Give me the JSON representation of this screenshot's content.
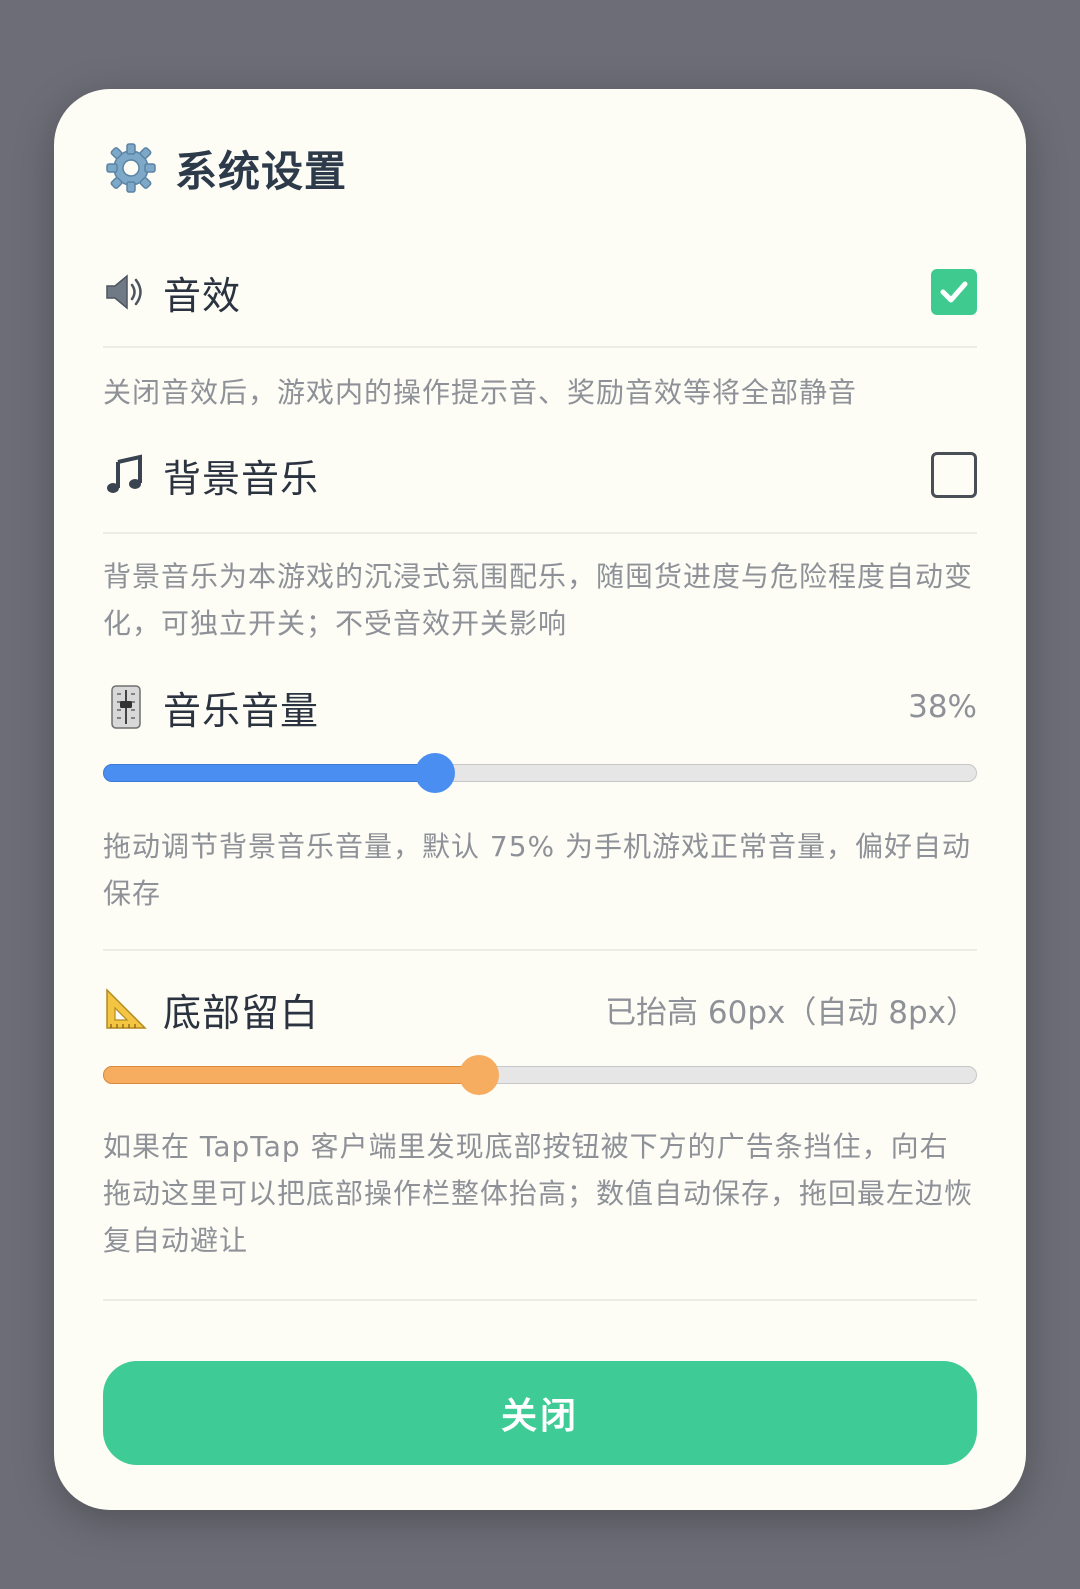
{
  "dialog": {
    "title": "系统设置",
    "title_icon": "gear-icon",
    "close_label": "关闭"
  },
  "settings": {
    "sound_effects": {
      "icon": "speaker-icon",
      "label": "音效",
      "checked": true,
      "description": "关闭音效后，游戏内的操作提示音、奖励音效等将全部静音"
    },
    "background_music": {
      "icon": "music-note-icon",
      "label": "背景音乐",
      "checked": false,
      "description": "背景音乐为本游戏的沉浸式氛围配乐，随囤货进度与危险程度自动变化，可独立开关；不受音效开关影响"
    },
    "music_volume": {
      "icon": "mixer-slider-icon",
      "label": "音乐音量",
      "value_text": "38%",
      "value": 0.38,
      "description": "拖动调节背景音乐音量，默认 75% 为手机游戏正常音量，偏好自动保存"
    },
    "bottom_margin": {
      "icon": "triangular-ruler-icon",
      "label": "底部留白",
      "value_text": "已抬高 60px（自动 8px）",
      "value": 0.43,
      "description": "如果在 TapTap 客户端里发现底部按钮被下方的广告条挡住，向右拖动这里可以把底部操作栏整体抬高；数值自动保存，拖回最左边恢复自动避让"
    }
  },
  "colors": {
    "accent_green": "#3fcb8f",
    "slider_blue": "#4a8ef1",
    "slider_orange": "#f6ad60"
  }
}
